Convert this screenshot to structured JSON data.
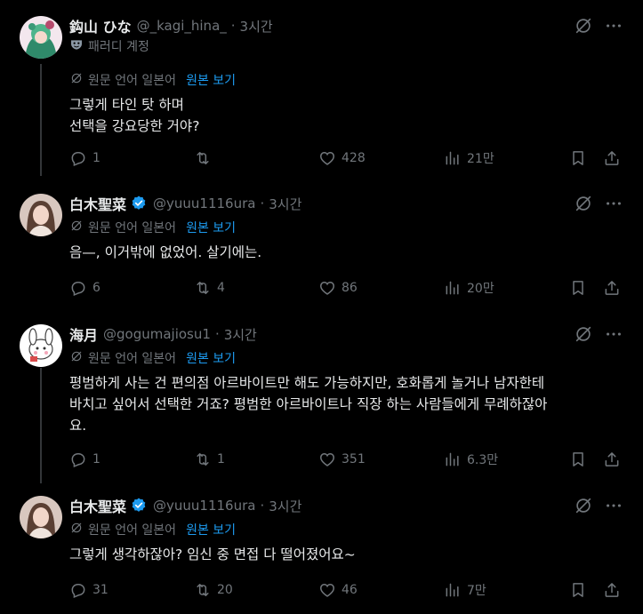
{
  "tweets": [
    {
      "name": "鈎山 ひな",
      "handle": "@_kagi_hina_",
      "time": "3시간",
      "verified": false,
      "parody_label": "패러디 계정",
      "translate": {
        "label": "원문 언어 일본어",
        "show_original": "원본 보기"
      },
      "text": "그렇게 타인 탓 하며\n선택을 강요당한 거야?",
      "replies": "1",
      "reposts": "",
      "likes": "428",
      "views": "21만"
    },
    {
      "name": "白木聖菜",
      "handle": "@yuuu1116ura",
      "time": "3시간",
      "verified": true,
      "translate": {
        "label": "원문 언어 일본어",
        "show_original": "원본 보기"
      },
      "text": "음—, 이거밖에 없었어. 살기에는.",
      "replies": "6",
      "reposts": "4",
      "likes": "86",
      "views": "20만"
    },
    {
      "name": "海月",
      "handle": "@gogumajiosu1",
      "time": "3시간",
      "verified": false,
      "translate": {
        "label": "원문 언어 일본어",
        "show_original": "원본 보기"
      },
      "text": "평범하게 사는 건 편의점 아르바이트만 해도 가능하지만, 호화롭게 놀거나 남자한테\n바치고 싶어서 선택한 거죠? 평범한 아르바이트나 직장 하는 사람들에게 무례하잖아\n요.",
      "replies": "1",
      "reposts": "1",
      "likes": "351",
      "views": "6.3만"
    },
    {
      "name": "白木聖菜",
      "handle": "@yuuu1116ura",
      "time": "3시간",
      "verified": true,
      "translate": {
        "label": "원문 언어 일본어",
        "show_original": "원본 보기"
      },
      "text": "그렇게 생각하잖아? 임신 중 면접 다 떨어졌어요~",
      "replies": "31",
      "reposts": "20",
      "likes": "46",
      "views": "7만"
    }
  ],
  "icons": {
    "more": "more-icon",
    "grok": "grok-icon",
    "reply": "reply-icon",
    "repost": "repost-icon",
    "like": "like-icon",
    "views": "views-icon",
    "bookmark": "bookmark-icon",
    "share": "share-icon",
    "verified": "verified-badge-icon",
    "parody": "parody-mask-icon",
    "translate": "translate-icon"
  },
  "colors": {
    "background": "#000000",
    "text": "#e7e9ea",
    "muted": "#71767b",
    "accent": "#1d9bf0",
    "line": "#333639"
  }
}
